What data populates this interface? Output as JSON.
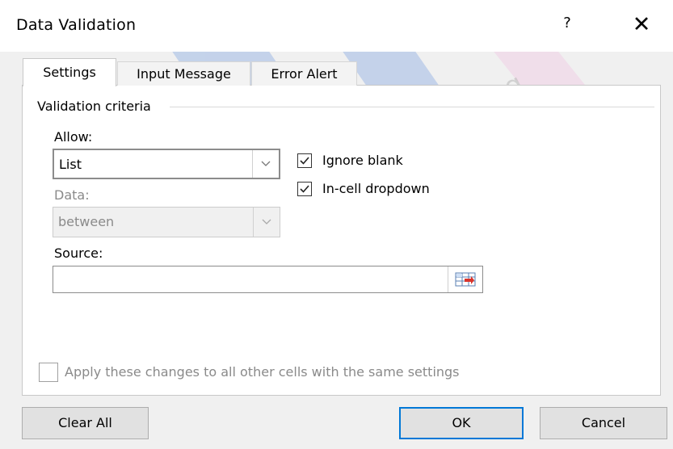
{
  "dialog": {
    "title": "Data Validation",
    "help_glyph": "?",
    "close_glyph": "✕"
  },
  "tabs": [
    {
      "label": "Settings",
      "active": true
    },
    {
      "label": "Input Message",
      "active": false
    },
    {
      "label": "Error Alert",
      "active": false
    }
  ],
  "settings": {
    "group_title": "Validation criteria",
    "allow": {
      "label": "Allow:",
      "value": "List"
    },
    "data": {
      "label": "Data:",
      "value": "between",
      "disabled": true
    },
    "ignore_blank": {
      "label": "Ignore blank",
      "checked": true
    },
    "in_cell_dropdown": {
      "label": "In-cell dropdown",
      "checked": true
    },
    "source": {
      "label": "Source:",
      "value": ""
    },
    "apply_all": {
      "label": "Apply these changes to all other cells with the same settings",
      "checked": false,
      "disabled": true
    }
  },
  "buttons": {
    "clear_all": "Clear All",
    "ok": "OK",
    "cancel": "Cancel"
  },
  "watermark_text": "Learning",
  "colors": {
    "accent": "#0078d7",
    "watermark_blue": "#2b6cd6",
    "watermark_pink": "#f4a3d8"
  }
}
